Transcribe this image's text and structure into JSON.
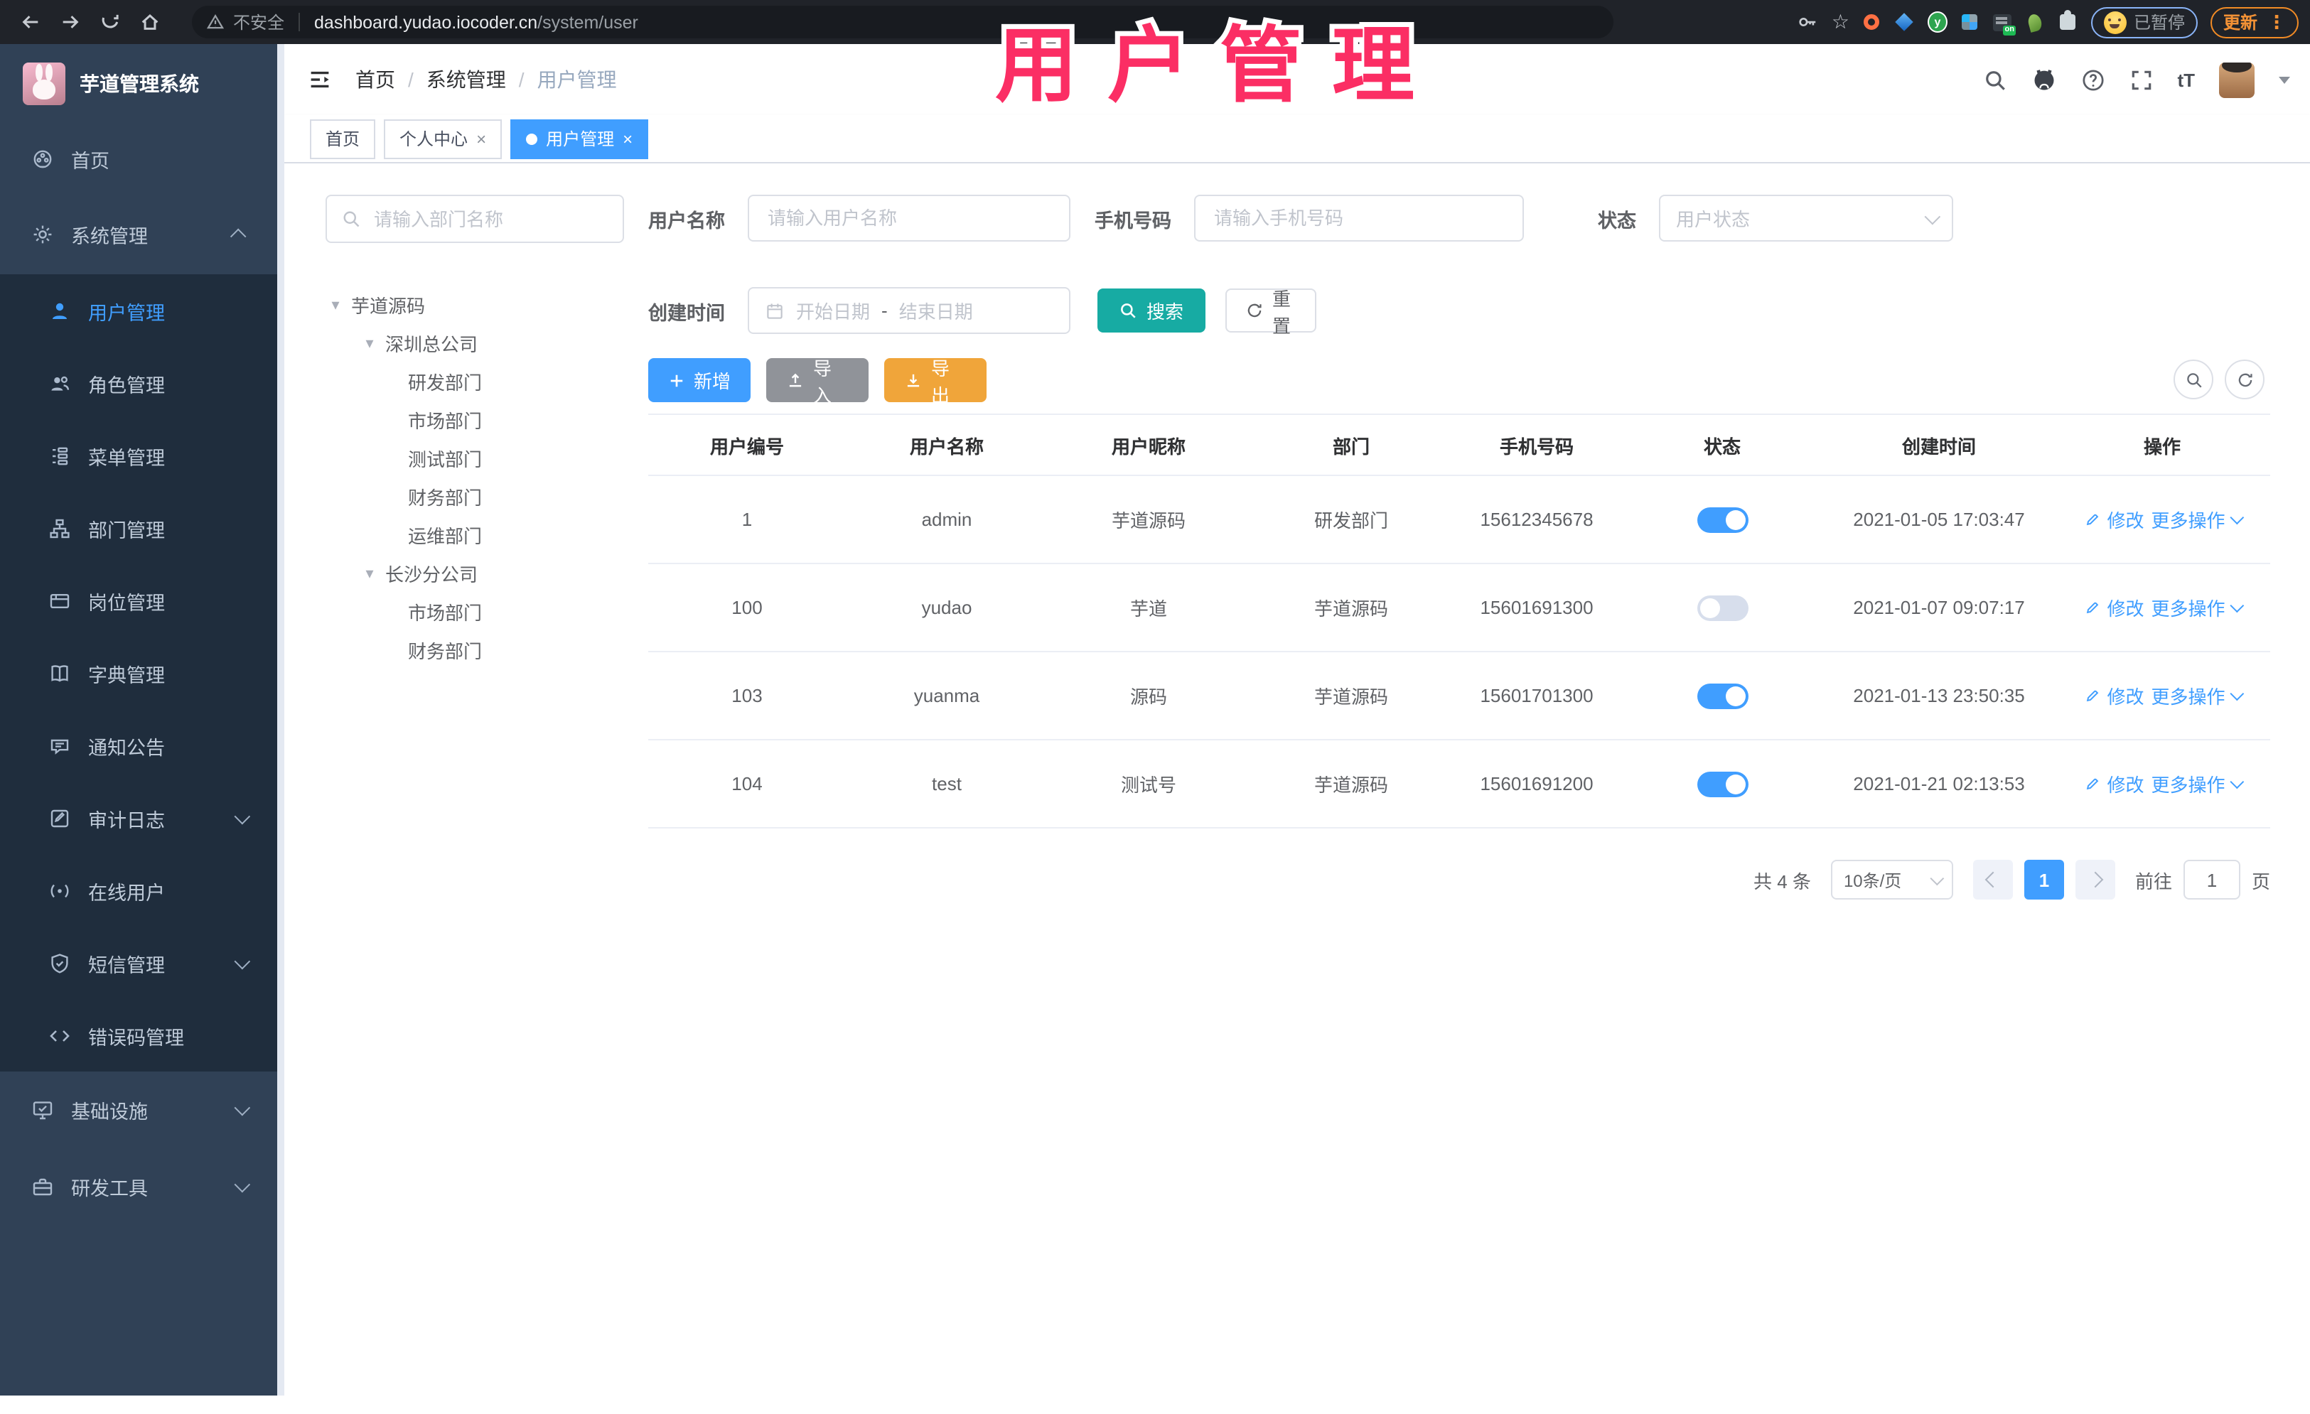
{
  "browser": {
    "security": "不安全",
    "host": "dashboard.yudao.iocoder.cn",
    "path": "/system/user",
    "profile_status": "已暂停",
    "update_label": "更新"
  },
  "overlay": {
    "title": "用户管理",
    "color": "#fb2e64"
  },
  "sidebar": {
    "logo": "芋道管理系统",
    "items": [
      {
        "label": "首页"
      },
      {
        "label": "系统管理"
      },
      {
        "label": "用户管理"
      },
      {
        "label": "角色管理"
      },
      {
        "label": "菜单管理"
      },
      {
        "label": "部门管理"
      },
      {
        "label": "岗位管理"
      },
      {
        "label": "字典管理"
      },
      {
        "label": "通知公告"
      },
      {
        "label": "审计日志"
      },
      {
        "label": "在线用户"
      },
      {
        "label": "短信管理"
      },
      {
        "label": "错误码管理"
      },
      {
        "label": "基础设施"
      },
      {
        "label": "研发工具"
      }
    ]
  },
  "breadcrumb": {
    "separator": "/",
    "items": [
      "首页",
      "系统管理",
      "用户管理"
    ]
  },
  "tags": [
    {
      "label": "首页"
    },
    {
      "label": "个人中心"
    },
    {
      "label": "用户管理"
    }
  ],
  "dept": {
    "search_placeholder": "请输入部门名称",
    "tree": [
      {
        "label": "芋道源码"
      },
      {
        "label": "深圳总公司"
      },
      {
        "label": "研发部门"
      },
      {
        "label": "市场部门"
      },
      {
        "label": "测试部门"
      },
      {
        "label": "财务部门"
      },
      {
        "label": "运维部门"
      },
      {
        "label": "长沙分公司"
      },
      {
        "label": "市场部门"
      },
      {
        "label": "财务部门"
      }
    ]
  },
  "filters": {
    "username_label": "用户名称",
    "username_placeholder": "请输入用户名称",
    "mobile_label": "手机号码",
    "mobile_placeholder": "请输入手机号码",
    "status_label": "状态",
    "status_placeholder": "用户状态",
    "created_label": "创建时间",
    "start_placeholder": "开始日期",
    "range_separator": "-",
    "end_placeholder": "结束日期",
    "search": "搜索",
    "reset": "重置"
  },
  "toolbar": {
    "add": "新增",
    "import": "导入",
    "export": "导出"
  },
  "table": {
    "columns": [
      "用户编号",
      "用户名称",
      "用户昵称",
      "部门",
      "手机号码",
      "状态",
      "创建时间",
      "操作"
    ],
    "edit": "修改",
    "more": "更多操作",
    "rows": [
      {
        "id": "1",
        "username": "admin",
        "nickname": "芋道源码",
        "dept": "研发部门",
        "mobile": "15612345678",
        "enabled": true,
        "created": "2021-01-05 17:03:47"
      },
      {
        "id": "100",
        "username": "yudao",
        "nickname": "芋道",
        "dept": "芋道源码",
        "mobile": "15601691300",
        "enabled": false,
        "created": "2021-01-07 09:07:17"
      },
      {
        "id": "103",
        "username": "yuanma",
        "nickname": "源码",
        "dept": "芋道源码",
        "mobile": "15601701300",
        "enabled": true,
        "created": "2021-01-13 23:50:35"
      },
      {
        "id": "104",
        "username": "test",
        "nickname": "测试号",
        "dept": "芋道源码",
        "mobile": "15601691200",
        "enabled": true,
        "created": "2021-01-21 02:13:53"
      }
    ]
  },
  "pagination": {
    "total": "共 4 条",
    "page_size": "10条/页",
    "page": "1",
    "goto_label": "前往",
    "goto_value": "1",
    "unit": "页"
  },
  "colors": {
    "primary": "#409eff",
    "search_button": "#17aba3",
    "import_button": "#909399",
    "export_button": "#f0a53a",
    "sidebar_bg": "#304156",
    "submenu_bg": "#1f2d3d",
    "overlay_pink": "#fb2e64"
  }
}
